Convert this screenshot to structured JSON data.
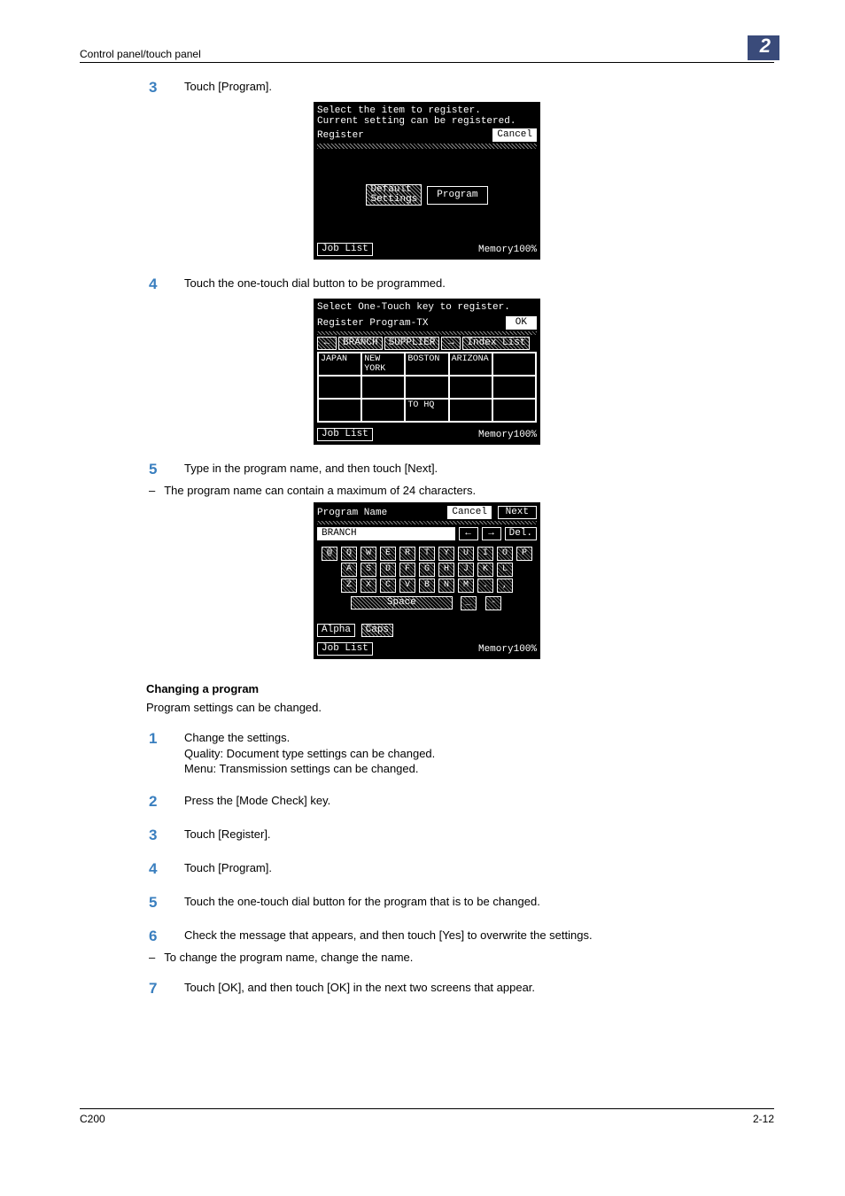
{
  "header": {
    "left": "Control panel/touch panel",
    "badge": "2"
  },
  "footer": {
    "left": "C200",
    "right": "2-12"
  },
  "step3": {
    "num": "3",
    "text": "Touch [Program]."
  },
  "panel1": {
    "line1": "Select the item to register.",
    "line2": "Current setting can be registered.",
    "register": "Register",
    "cancel": "Cancel",
    "default": "Default\nSettings",
    "program": "Program",
    "joblist": "Job List",
    "memory": "Memory100%"
  },
  "step4": {
    "num": "4",
    "text": "Touch the one-touch dial button to be programmed."
  },
  "panel2": {
    "line1": "Select One-Touch key to register.",
    "title": "Register Program-TX",
    "ok": "OK",
    "tabs": {
      "left": "←",
      "branch": "BRANCH",
      "supplier": "SUPPLIER",
      "right": "→",
      "index": "Index List"
    },
    "cells": [
      "JAPAN",
      "NEW YORK",
      "BOSTON",
      "ARIZONA",
      "",
      "",
      "",
      "",
      "",
      "",
      "",
      "",
      "TO HQ",
      "",
      ""
    ],
    "joblist": "Job List",
    "memory": "Memory100%"
  },
  "step5": {
    "num": "5",
    "text": "Type in the program name, and then touch [Next].",
    "sub": "The program name can contain a maximum of 24 characters."
  },
  "panel3": {
    "title": "Program Name",
    "cancel": "Cancel",
    "next": "Next",
    "input": "BRANCH",
    "left": "←",
    "right": "→",
    "del": "Del.",
    "rows": [
      [
        "@",
        "Q",
        "W",
        "E",
        "R",
        "T",
        "Y",
        "U",
        "I",
        "O",
        "P"
      ],
      [
        "A",
        "S",
        "D",
        "F",
        "G",
        "H",
        "J",
        "K",
        "L"
      ],
      [
        "Z",
        "X",
        "C",
        "V",
        "B",
        "N",
        "M",
        ".",
        ","
      ]
    ],
    "space": "Space",
    "under": "_",
    "hyph": "-",
    "alpha": "Alpha",
    "caps": "Caps",
    "joblist": "Job List",
    "memory": "Memory100%"
  },
  "changing": {
    "heading": "Changing a program",
    "intro": "Program settings can be changed."
  },
  "csteps": [
    {
      "num": "1",
      "lines": [
        "Change the settings.",
        "Quality: Document type settings can be changed.",
        "Menu: Transmission settings can be changed."
      ]
    },
    {
      "num": "2",
      "lines": [
        "Press the [Mode Check] key."
      ]
    },
    {
      "num": "3",
      "lines": [
        "Touch [Register]."
      ]
    },
    {
      "num": "4",
      "lines": [
        "Touch [Program]."
      ]
    },
    {
      "num": "5",
      "lines": [
        "Touch the one-touch dial button for the program that is to be changed."
      ]
    },
    {
      "num": "6",
      "lines": [
        "Check the message that appears, and then touch [Yes] to overwrite the settings."
      ],
      "sub": "To change the program name, change the name."
    },
    {
      "num": "7",
      "lines": [
        "Touch [OK], and then touch [OK] in the next two screens that appear."
      ]
    }
  ]
}
